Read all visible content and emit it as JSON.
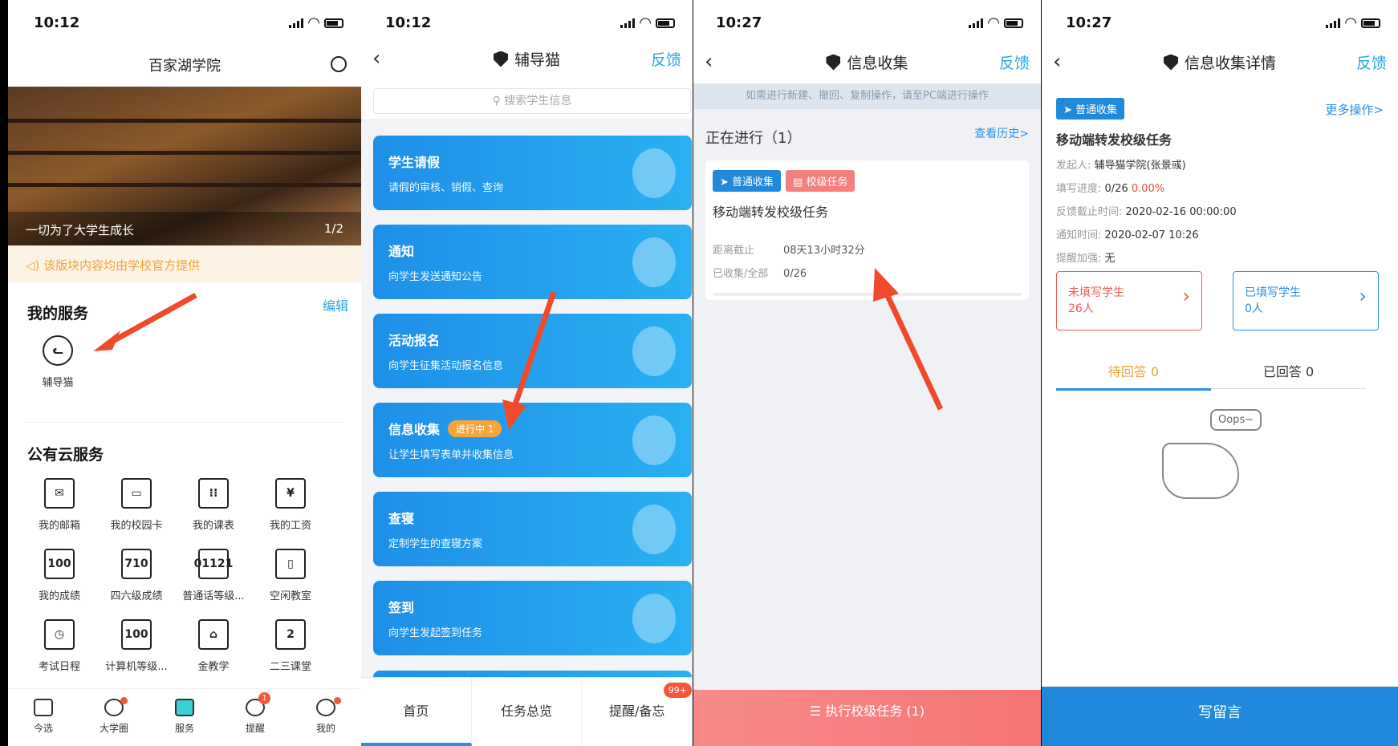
{
  "panel1": {
    "time": "10:12",
    "title": "百家湖学院",
    "banner_caption": "一切为了大学生成长",
    "banner_page": "1/2",
    "notice": "该版块内容均由学校官方提供",
    "my_services": "我的服务",
    "edit": "编辑",
    "fudaomao": "辅导猫",
    "public_services": "公有云服务",
    "services": [
      {
        "icon": "envelope-icon",
        "glyph": "✉",
        "label": "我的邮箱"
      },
      {
        "icon": "card-icon",
        "glyph": "▭",
        "label": "我的校园卡"
      },
      {
        "icon": "calendar-icon",
        "glyph": "⁝⁝",
        "label": "我的课表"
      },
      {
        "icon": "yen-icon",
        "glyph": "¥",
        "label": "我的工资"
      },
      {
        "icon": "score-icon",
        "glyph": "100",
        "label": "我的成绩"
      },
      {
        "icon": "cet-icon",
        "glyph": "710",
        "label": "四六级成绩"
      },
      {
        "icon": "mandarin-icon",
        "glyph": "01121",
        "label": "普通话等级..."
      },
      {
        "icon": "classroom-icon",
        "glyph": "▯",
        "label": "空闲教室"
      },
      {
        "icon": "exam-icon",
        "glyph": "◷",
        "label": "考试日程"
      },
      {
        "icon": "computer-level-icon",
        "glyph": "100",
        "label": "计算机等级..."
      },
      {
        "icon": "jinjiaoxue-icon",
        "glyph": "⌂",
        "label": "金教学"
      },
      {
        "icon": "second-classroom-icon",
        "glyph": "2",
        "label": "二三课堂"
      }
    ],
    "tabs": [
      "今选",
      "大学圈",
      "服务",
      "提醒",
      "我的"
    ],
    "remind_badge": "1"
  },
  "panel2": {
    "time": "10:12",
    "title": "辅导猫",
    "feedback": "反馈",
    "search_placeholder": "搜索学生信息",
    "cards": [
      {
        "title": "学生请假",
        "sub": "请假的审核、销假、查询",
        "badge": ""
      },
      {
        "title": "通知",
        "sub": "向学生发送通知公告",
        "badge": ""
      },
      {
        "title": "活动报名",
        "sub": "向学生征集活动报名信息",
        "badge": ""
      },
      {
        "title": "信息收集",
        "sub": "让学生填写表单并收集信息",
        "badge": "进行中 1"
      },
      {
        "title": "查寝",
        "sub": "定制学生的查寝方案",
        "badge": ""
      },
      {
        "title": "签到",
        "sub": "向学生发起签到任务",
        "badge": ""
      }
    ],
    "tabs": [
      "首页",
      "任务总览",
      "提醒/备忘"
    ],
    "tab_badge": "99+"
  },
  "panel3": {
    "time": "10:27",
    "title": "信息收集",
    "feedback": "反馈",
    "tip": "如需进行新建、撤回、复制操作，请至PC端进行操作",
    "in_progress": "正在进行（1）",
    "history": "查看历史>",
    "tag1": "普通收集",
    "tag2": "校级任务",
    "task": "移动端转发校级任务",
    "deadline_label": "距离截止",
    "deadline": "08天13小时32分",
    "collected_label": "已收集/全部",
    "collected": "0/26",
    "exec": "执行校级任务 (1)"
  },
  "panel4": {
    "time": "10:27",
    "title": "信息收集详情",
    "feedback": "反馈",
    "tag": "普通收集",
    "more": "更多操作>",
    "task": "移动端转发校级任务",
    "initiator_label": "发起人:",
    "initiator": "辅导猫学院(张景彧)",
    "progress_label": "填写进度:",
    "progress": "0/26",
    "progress_pct": "0.00%",
    "deadline_label": "反馈截止时间:",
    "deadline": "2020-02-16 00:00:00",
    "notify_label": "通知时间:",
    "notify": "2020-02-07 10:26",
    "remind_label": "提醒加强:",
    "remind": "无",
    "unfilled_label": "未填写学生",
    "unfilled": "26人",
    "filled_label": "已填写学生",
    "filled": "0人",
    "tab_pending": "待回答 0",
    "tab_answered": "已回答 0",
    "oops": "Oops~",
    "write": "写留言"
  }
}
